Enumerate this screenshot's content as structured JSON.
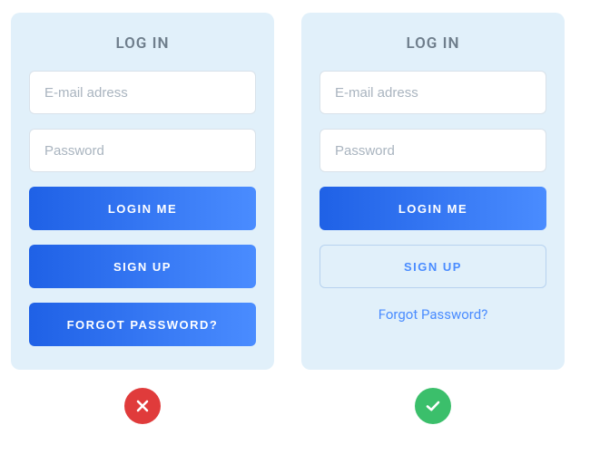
{
  "bad": {
    "title": "LOG IN",
    "email_placeholder": "E-mail adress",
    "password_placeholder": "Password",
    "login_label": "LOGIN ME",
    "signup_label": "SIGN UP",
    "forgot_label": "FORGOT PASSWORD?",
    "verdict": "cross"
  },
  "good": {
    "title": "LOG IN",
    "email_placeholder": "E-mail adress",
    "password_placeholder": "Password",
    "login_label": "LOGIN ME",
    "signup_label": "SIGN UP",
    "forgot_label": "Forgot Password?",
    "verdict": "check"
  },
  "colors": {
    "card_bg": "#e1f0fa",
    "primary_grad_from": "#1f61e6",
    "primary_grad_to": "#4a8cff",
    "link": "#4a8cff",
    "bad": "#e03b3b",
    "good": "#3bbf6b"
  }
}
